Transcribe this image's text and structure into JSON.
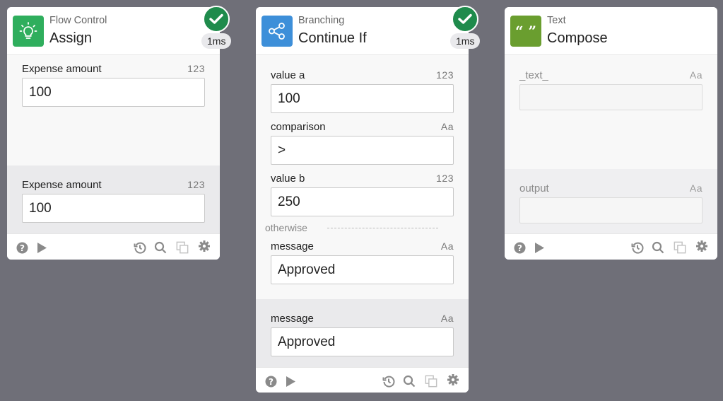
{
  "cards": [
    {
      "category": "Flow Control",
      "title": "Assign",
      "category_color": "#2fae5d",
      "icon": "lightbulb-icon",
      "status": "success",
      "duration": "1ms",
      "inputs": [
        {
          "label": "Expense amount",
          "type": "123",
          "value": "100"
        }
      ],
      "outputs": [
        {
          "label": "Expense amount",
          "type": "123",
          "value": "100"
        }
      ]
    },
    {
      "category": "Branching",
      "title": "Continue If",
      "category_color": "#3d8fd9",
      "icon": "share-nodes-icon",
      "status": "success",
      "duration": "1ms",
      "inputs": [
        {
          "label": "value a",
          "type": "123",
          "value": "100"
        },
        {
          "label": "comparison",
          "type": "Aa",
          "value": ">"
        },
        {
          "label": "value b",
          "type": "123",
          "value": "250"
        }
      ],
      "otherwise_label": "otherwise",
      "otherwise_inputs": [
        {
          "label": "message",
          "type": "Aa",
          "value": "Approved"
        }
      ],
      "outputs": [
        {
          "label": "message",
          "type": "Aa",
          "value": "Approved"
        }
      ]
    },
    {
      "category": "Text",
      "title": "Compose",
      "category_color": "#6a9e2f",
      "icon": "quote-icon",
      "icon_glyph": "“ ”",
      "inputs": [
        {
          "label": "_text_",
          "type": "Aa",
          "value": ""
        }
      ],
      "outputs": [
        {
          "label": "output",
          "type": "Aa",
          "value": ""
        }
      ]
    }
  ],
  "footer_icons": [
    "help-icon",
    "play-icon",
    "history-icon",
    "search-icon",
    "copy-icon",
    "gear-icon"
  ],
  "colors": {
    "background": "#6f6f78",
    "success": "#1f8b4c"
  }
}
